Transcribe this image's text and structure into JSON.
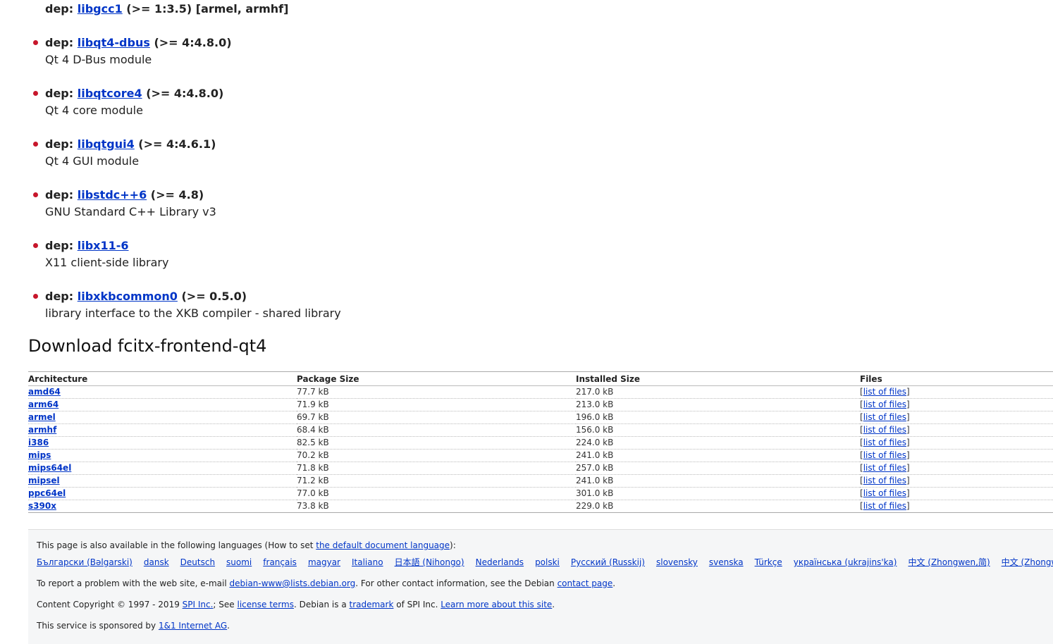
{
  "top_dep": {
    "prefix": "dep:",
    "name": "libgcc1",
    "rest": "(>= 1:3.5) [armel, armhf]"
  },
  "deps": [
    {
      "prefix": "dep:",
      "name": "libqt4-dbus",
      "rest": "(>= 4:4.8.0)",
      "desc": "Qt 4 D-Bus module"
    },
    {
      "prefix": "dep:",
      "name": "libqtcore4",
      "rest": "(>= 4:4.8.0)",
      "desc": "Qt 4 core module"
    },
    {
      "prefix": "dep:",
      "name": "libqtgui4",
      "rest": "(>= 4:4.6.1)",
      "desc": "Qt 4 GUI module"
    },
    {
      "prefix": "dep:",
      "name": "libstdc++6",
      "rest": "(>= 4.8)",
      "desc": "GNU Standard C++ Library v3"
    },
    {
      "prefix": "dep:",
      "name": "libx11-6",
      "rest": "",
      "desc": "X11 client-side library"
    },
    {
      "prefix": "dep:",
      "name": "libxkbcommon0",
      "rest": "(>= 0.5.0)",
      "desc": "library interface to the XKB compiler - shared library"
    }
  ],
  "download": {
    "title": "Download fcitx-frontend-qt4",
    "headers": [
      "Architecture",
      "Package Size",
      "Installed Size",
      "Files"
    ],
    "rows": [
      {
        "arch": "amd64",
        "pkg": "77.7 kB",
        "inst": "217.0 kB",
        "files": "list of files"
      },
      {
        "arch": "arm64",
        "pkg": "71.9 kB",
        "inst": "213.0 kB",
        "files": "list of files"
      },
      {
        "arch": "armel",
        "pkg": "69.7 kB",
        "inst": "196.0 kB",
        "files": "list of files"
      },
      {
        "arch": "armhf",
        "pkg": "68.4 kB",
        "inst": "156.0 kB",
        "files": "list of files"
      },
      {
        "arch": "i386",
        "pkg": "82.5 kB",
        "inst": "224.0 kB",
        "files": "list of files"
      },
      {
        "arch": "mips",
        "pkg": "70.2 kB",
        "inst": "241.0 kB",
        "files": "list of files"
      },
      {
        "arch": "mips64el",
        "pkg": "71.8 kB",
        "inst": "257.0 kB",
        "files": "list of files"
      },
      {
        "arch": "mipsel",
        "pkg": "71.2 kB",
        "inst": "241.0 kB",
        "files": "list of files"
      },
      {
        "arch": "ppc64el",
        "pkg": "77.0 kB",
        "inst": "301.0 kB",
        "files": "list of files"
      },
      {
        "arch": "s390x",
        "pkg": "73.8 kB",
        "inst": "229.0 kB",
        "files": "list of files"
      }
    ]
  },
  "footer": {
    "lang_intro": "This page is also available in the following languages (How to set ",
    "lang_link": "the default document language",
    "lang_outro": "):",
    "languages": [
      "Български (Bəlgarski)",
      "dansk",
      "Deutsch",
      "suomi",
      "français",
      "magyar",
      "Italiano",
      "日本語 (Nihongo)",
      "Nederlands",
      "polski",
      "Русский (Russkij)",
      "slovensky",
      "svenska",
      "Türkçe",
      "українська (ukrajins'ka)",
      "中文 (Zhongwen,简)",
      "中文 (Zhongwen,繁)"
    ],
    "report_text": "To report a problem with the web site, e-mail ",
    "report_email": "debian-www@lists.debian.org",
    "report_mid": ". For other contact information, see the Debian ",
    "report_link": "contact page",
    "report_end": ".",
    "copy_text": "Content Copyright © 1997 - 2019 ",
    "copy_spi": "SPI Inc.",
    "copy_see": "; See ",
    "copy_license": "license terms",
    "copy_debian": ". Debian is a ",
    "copy_trademark": "trademark",
    "copy_of": " of SPI Inc. ",
    "copy_learn": "Learn more about this site",
    "copy_end": ".",
    "sponsor_text": "This service is sponsored by ",
    "sponsor_link": "1&1 Internet AG",
    "sponsor_end": "."
  }
}
